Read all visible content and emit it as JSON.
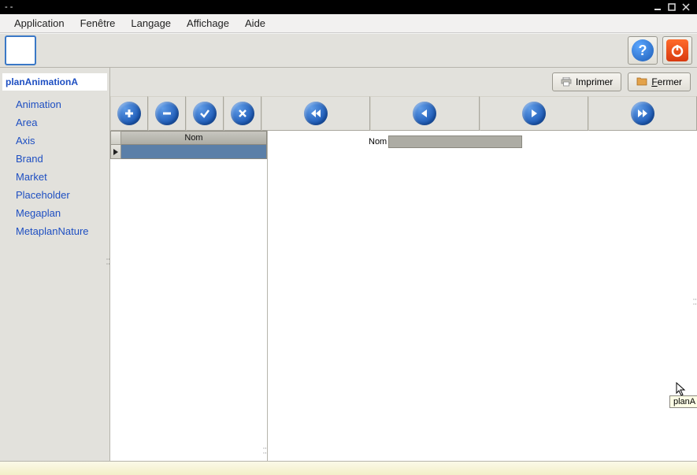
{
  "window": {
    "title": "- -"
  },
  "menubar": {
    "application": "Application",
    "fenetre": "Fenêtre",
    "langage": "Langage",
    "affichage": "Affichage",
    "aide": "Aide"
  },
  "toolbar": {
    "help_icon_label": "?",
    "imprimer": "Imprimer",
    "fermer": "Fermer"
  },
  "sidebar": {
    "title": "planAnimationA",
    "items": [
      "Animation",
      "Area",
      "Axis",
      "Brand",
      "Market",
      "Placeholder",
      "Megaplan",
      "MetaplanNature"
    ]
  },
  "table": {
    "header": "Nom"
  },
  "form": {
    "nom_label": "Nom"
  },
  "tooltip": {
    "text": "planA"
  }
}
